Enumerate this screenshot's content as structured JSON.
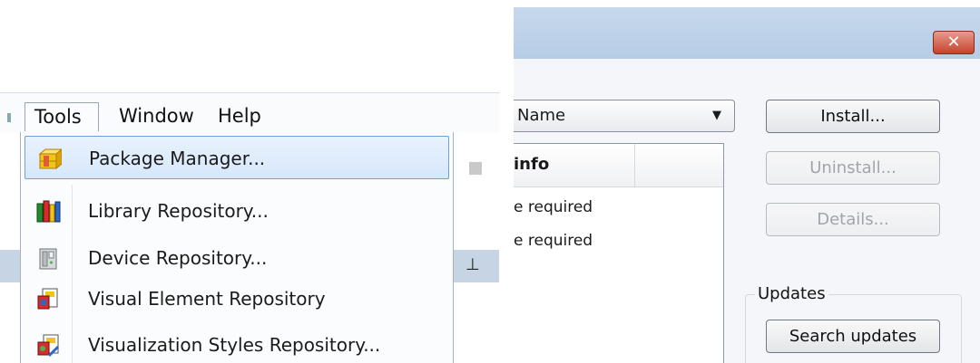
{
  "menubar": {
    "items": [
      {
        "label": "Tools"
      },
      {
        "label": "Window"
      },
      {
        "label": "Help"
      }
    ]
  },
  "tools_menu": {
    "items": [
      {
        "label": "Package Manager...",
        "icon": "package-manager-icon",
        "selected": true
      },
      {
        "label": "Library Repository...",
        "icon": "library-books-icon",
        "selected": false
      },
      {
        "label": "Device Repository...",
        "icon": "device-icon",
        "selected": false
      },
      {
        "label": "Visual Element Repository",
        "icon": "visual-element-icon",
        "selected": false
      },
      {
        "label": "Visualization Styles Repository...",
        "icon": "visualization-styles-icon",
        "selected": false
      }
    ]
  },
  "dialog": {
    "close_label": "✕",
    "sort_combo": {
      "value": "Name"
    },
    "list": {
      "columns": [
        {
          "label": "info"
        }
      ],
      "rows": [
        {
          "text": "e required"
        },
        {
          "text": "e required"
        }
      ]
    },
    "buttons": {
      "install": "Install...",
      "uninstall": "Uninstall...",
      "details": "Details..."
    },
    "updates": {
      "group_label": "Updates",
      "search_button": "Search updates"
    }
  },
  "colors": {
    "menu_highlight": "#d6e7fb",
    "titlebar": "#b7cde6",
    "close_button": "#c5432c"
  }
}
